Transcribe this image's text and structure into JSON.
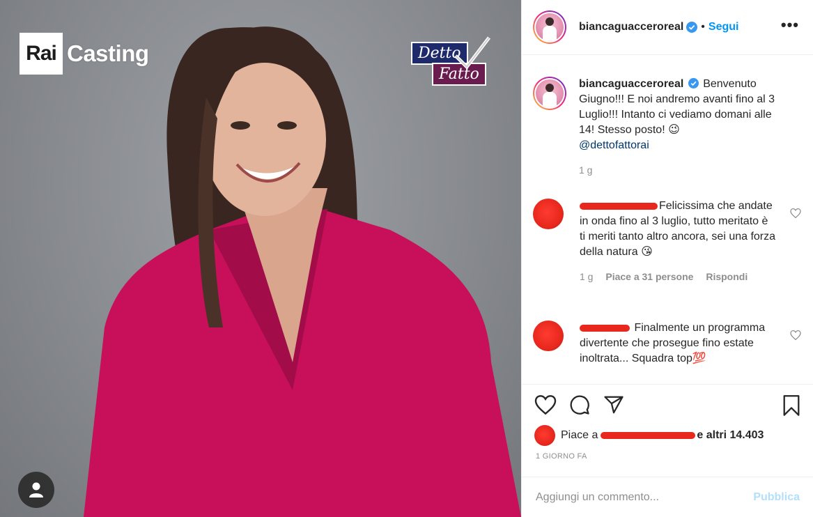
{
  "photo": {
    "rai_logo_box": "Rai",
    "rai_logo_text": "Casting",
    "show_logo_line1": "Detto",
    "show_logo_line2": "Fatto",
    "alt": "photo"
  },
  "header": {
    "username": "biancaguaccero­real",
    "separator": "•",
    "follow_label": "Segui",
    "more_label": "•••"
  },
  "caption": {
    "username": "biancaguacceroreal",
    "text": "Benvenuto Giugno!!! E noi andremo avanti fino al 3 Luglio!!! Intanto ci vediamo domani alle 14! Stesso posto! 😉",
    "mention": "@dettofattorai",
    "age": "1 g"
  },
  "comments": [
    {
      "text_after_redaction": "Felicissima che andate in onda fino al 3 luglio, tutto meritato è ti meriti tanto altro ancora, sei una forza della natura 😘",
      "age": "1 g",
      "likes_label": "Piace a 31 persone",
      "reply_label": "Rispondi"
    },
    {
      "text_after_redaction": "Finalmente un programma divertente che prosegue fino estate inoltrata... Squadra top💯"
    }
  ],
  "likes": {
    "prefix": "Piace a",
    "suffix": "e altri 14.403"
  },
  "post_time": "1 GIORNO FA",
  "add_comment": {
    "placeholder": "Aggiungi un commento...",
    "publish_label": "Pubblica"
  },
  "colors": {
    "accent": "#0095f6",
    "redaction": "#e8281d",
    "secondary_text": "#8e8e8e"
  }
}
